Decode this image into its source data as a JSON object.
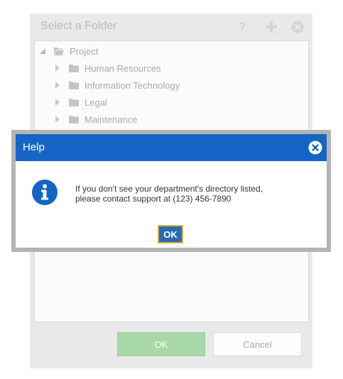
{
  "folder_dialog": {
    "title": "Select a Folder",
    "toolbar": {
      "help_icon": "question-icon",
      "add_icon": "plus-icon",
      "close_icon": "close-circle-icon",
      "help_label": "?"
    },
    "tree": {
      "root": {
        "label": "Project",
        "icon": "folder-open-icon",
        "expanded": true
      },
      "children": [
        {
          "label": "Human Resources",
          "icon": "folder-icon"
        },
        {
          "label": "Information Technology",
          "icon": "folder-icon"
        },
        {
          "label": "Legal",
          "icon": "folder-icon"
        },
        {
          "label": "Maintenance",
          "icon": "folder-icon"
        }
      ]
    },
    "footer": {
      "ok_label": "OK",
      "cancel_label": "Cancel"
    }
  },
  "help_dialog": {
    "title": "Help",
    "icon": "info-icon",
    "message": "If you don't see your department's directory listed,\nplease contact support at (123) 456-7890",
    "ok_label": "OK"
  },
  "colors": {
    "help_header": "#1565c7",
    "ok_button": "#2a6ab3",
    "ok_focus_border": "#d7b243",
    "folder_ok_disabled": "#a8d8a8"
  }
}
